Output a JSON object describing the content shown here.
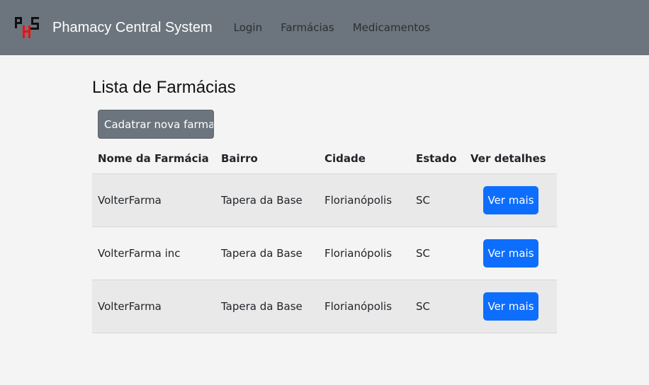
{
  "navbar": {
    "brand": "Phamacy Central System",
    "links": [
      "Login",
      "Farmácias",
      "Medicamentos"
    ]
  },
  "logo": {
    "icon": "phs-logo-icon"
  },
  "page": {
    "title": "Lista de Farmácias",
    "new_button_label": "Cadatrar nova farmacia"
  },
  "table": {
    "headers": [
      "Nome da Farmácia",
      "Bairro",
      "Cidade",
      "Estado",
      "Ver detalhes"
    ],
    "rows": [
      [
        "VolterFarma",
        "Tapera da Base",
        "Florianópolis",
        "SC",
        "Ver mais"
      ],
      [
        "VolterFarma inc",
        "Tapera da Base",
        "Florianópolis",
        "SC",
        "Ver mais"
      ],
      [
        "VolterFarma",
        "Tapera da Base",
        "Florianópolis",
        "SC",
        "Ver mais"
      ]
    ]
  },
  "colors": {
    "navbar": "#6c757d",
    "primary": "#0d6efd",
    "secondary": "#6c757d",
    "background": "#f4f4f4"
  }
}
